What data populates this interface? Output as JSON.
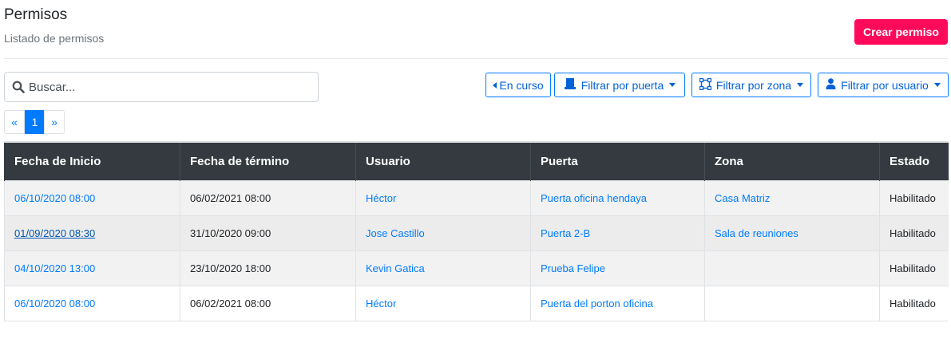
{
  "header": {
    "title": "Permisos",
    "subtitle": "Listado de permisos",
    "create_button": "Crear permiso"
  },
  "search": {
    "placeholder": "Buscar..."
  },
  "filters": {
    "en_curso": "En curso",
    "puerta": "Filtrar por puerta",
    "zona": "Filtrar por zona",
    "usuario": "Filtrar por usuario"
  },
  "pagination": {
    "prev": "«",
    "current": "1",
    "next": "»"
  },
  "table": {
    "columns": [
      "Fecha de Inicio",
      "Fecha de término",
      "Usuario",
      "Puerta",
      "Zona",
      "Estado"
    ],
    "rows": [
      {
        "inicio": "06/10/2020 08:00",
        "termino": "06/02/2021 08:00",
        "usuario": "Héctor",
        "puerta": "Puerta oficina hendaya",
        "zona": "Casa Matriz",
        "estado": "Habilitado"
      },
      {
        "inicio": "01/09/2020 08:30",
        "termino": "31/10/2020 09:00",
        "usuario": "Jose Castillo",
        "puerta": "Puerta 2-B",
        "zona": "Sala de reuniones",
        "estado": "Habilitado"
      },
      {
        "inicio": "04/10/2020 13:00",
        "termino": "23/10/2020 18:00",
        "usuario": "Kevin Gatica",
        "puerta": "Prueba Felipe",
        "zona": "",
        "estado": "Habilitado"
      },
      {
        "inicio": "06/10/2020 08:00",
        "termino": "06/02/2021 08:00",
        "usuario": "Héctor",
        "puerta": "Puerta del porton oficina",
        "zona": "",
        "estado": "Habilitado"
      }
    ]
  },
  "colors": {
    "accent": "#007bff",
    "create_button": "#ff0a5a",
    "table_header": "#343a40"
  },
  "icons": [
    "search-icon",
    "caret-left-icon",
    "door-icon",
    "zone-icon",
    "user-icon",
    "caret-down-icon"
  ]
}
